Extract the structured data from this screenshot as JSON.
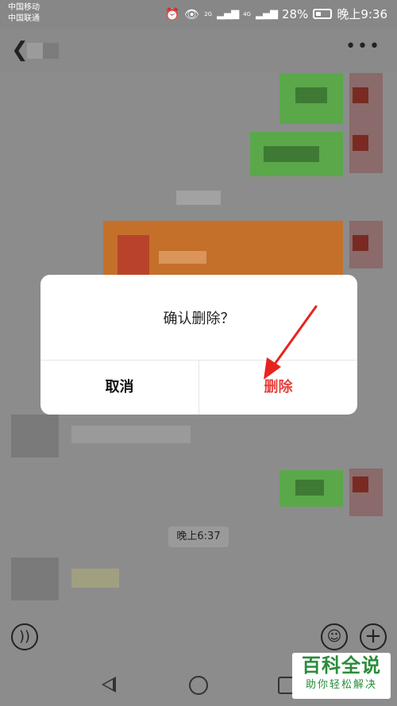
{
  "status_bar": {
    "carrier_1": "中国移动",
    "carrier_2": "中国联通",
    "net_1": "2G",
    "net_2": "4G",
    "battery": "28%",
    "time": "晚上9:36"
  },
  "chat": {
    "timestamp": "晚上6:37"
  },
  "dialog": {
    "title": "确认删除？",
    "cancel_label": "取消",
    "delete_label": "删除"
  },
  "watermark": {
    "main": "百科全说",
    "sub": "助你轻松解决"
  },
  "colors": {
    "delete_red": "#e64340",
    "arrow_red": "#e8231e",
    "bubble_green": "#5aa84a",
    "bubble_orange": "#c4702a"
  }
}
